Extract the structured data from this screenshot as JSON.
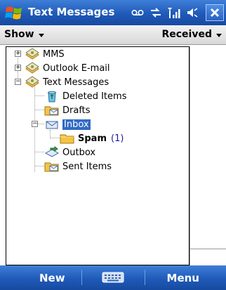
{
  "titlebar": {
    "title": "Text Messages"
  },
  "subheader": {
    "show_label": "Show",
    "received_label": "Received"
  },
  "tree": {
    "items": [
      {
        "label": "MMS"
      },
      {
        "label": "Outlook E-mail"
      },
      {
        "label": "Text Messages"
      },
      {
        "label": "Deleted Items"
      },
      {
        "label": "Drafts"
      },
      {
        "label": "Inbox"
      },
      {
        "label": "Spam",
        "count": "(1)"
      },
      {
        "label": "Outbox"
      },
      {
        "label": "Sent Items"
      }
    ]
  },
  "bottombar": {
    "left_label": "New",
    "right_label": "Menu"
  },
  "colors": {
    "titlebar": "#1f5ab8",
    "selection": "#316ac5",
    "count": "#1a1aa6"
  }
}
